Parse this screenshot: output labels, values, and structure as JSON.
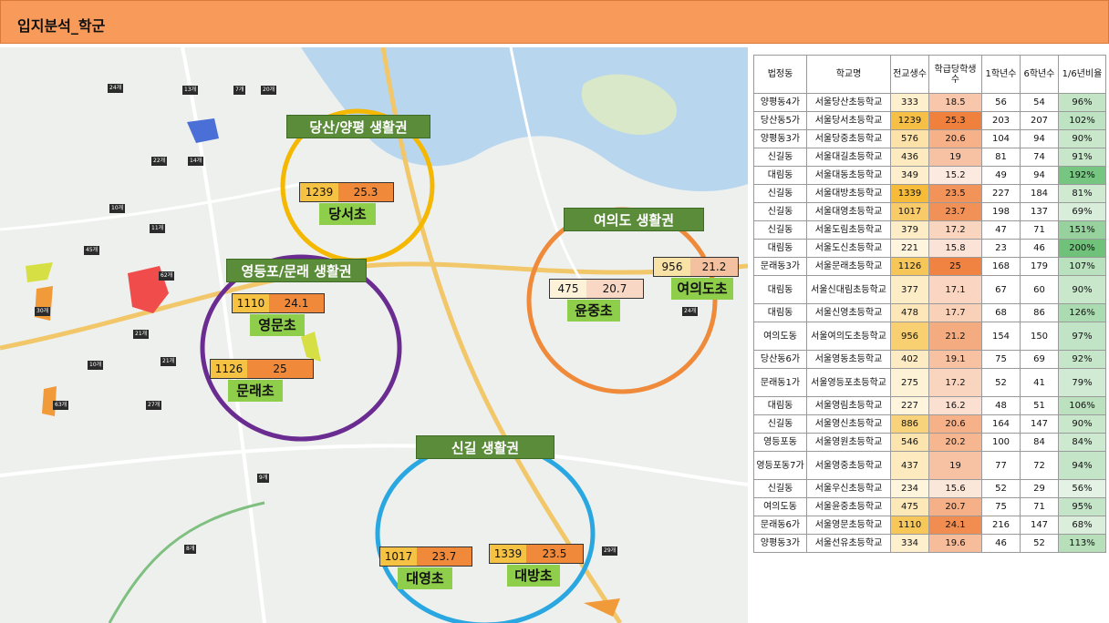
{
  "header": {
    "title": "입지분석_학군"
  },
  "map": {
    "zones": [
      {
        "label": "당산/양평 생활권",
        "color": "#f5b800"
      },
      {
        "label": "영등포/문래 생활권",
        "color": "#6a2c91"
      },
      {
        "label": "여의도  생활권",
        "color": "#ef8a3a"
      },
      {
        "label": "신길 생활권",
        "color": "#2aa7e0"
      }
    ],
    "schools": [
      {
        "name": "당서초",
        "students": "1239",
        "per_class": "25.3"
      },
      {
        "name": "영문초",
        "students": "1110",
        "per_class": "24.1"
      },
      {
        "name": "문래초",
        "students": "1126",
        "per_class": "25"
      },
      {
        "name": "윤중초",
        "students": "475",
        "per_class": "20.7"
      },
      {
        "name": "여의도초",
        "students": "956",
        "per_class": "21.2"
      },
      {
        "name": "대영초",
        "students": "1017",
        "per_class": "23.7"
      },
      {
        "name": "대방초",
        "students": "1339",
        "per_class": "23.5"
      }
    ]
  },
  "table": {
    "headers": [
      "법정동",
      "학교명",
      "전교생수",
      "학급당학생수",
      "1학년수",
      "6학년수",
      "1/6년비율"
    ],
    "rows": [
      [
        "양평동4가",
        "서울당산초등학교",
        "333",
        "18.5",
        "56",
        "54",
        "96%"
      ],
      [
        "당산동5가",
        "서울당서초등학교",
        "1239",
        "25.3",
        "203",
        "207",
        "102%"
      ],
      [
        "양평동3가",
        "서울당중초등학교",
        "576",
        "20.6",
        "104",
        "94",
        "90%"
      ],
      [
        "신길동",
        "서울대길초등학교",
        "436",
        "19",
        "81",
        "74",
        "91%"
      ],
      [
        "대림동",
        "서울대동초등학교",
        "349",
        "15.2",
        "49",
        "94",
        "192%"
      ],
      [
        "신길동",
        "서울대방초등학교",
        "1339",
        "23.5",
        "227",
        "184",
        "81%"
      ],
      [
        "신길동",
        "서울대영초등학교",
        "1017",
        "23.7",
        "198",
        "137",
        "69%"
      ],
      [
        "신길동",
        "서울도림초등학교",
        "379",
        "17.2",
        "47",
        "71",
        "151%"
      ],
      [
        "대림동",
        "서울도신초등학교",
        "221",
        "15.8",
        "23",
        "46",
        "200%"
      ],
      [
        "문래동3가",
        "서울문래초등학교",
        "1126",
        "25",
        "168",
        "179",
        "107%"
      ],
      [
        "대림동",
        "서울신대림초등학교",
        "377",
        "17.1",
        "67",
        "60",
        "90%"
      ],
      [
        "대림동",
        "서울신영초등학교",
        "478",
        "17.7",
        "68",
        "86",
        "126%"
      ],
      [
        "여의도동",
        "서울여의도초등학교",
        "956",
        "21.2",
        "154",
        "150",
        "97%"
      ],
      [
        "당산동6가",
        "서울영동초등학교",
        "402",
        "19.1",
        "75",
        "69",
        "92%"
      ],
      [
        "문래동1가",
        "서울영등포초등학교",
        "275",
        "17.2",
        "52",
        "41",
        "79%"
      ],
      [
        "대림동",
        "서울영림초등학교",
        "227",
        "16.2",
        "48",
        "51",
        "106%"
      ],
      [
        "신길동",
        "서울영신초등학교",
        "886",
        "20.6",
        "164",
        "147",
        "90%"
      ],
      [
        "영등포동",
        "서울영원초등학교",
        "546",
        "20.2",
        "100",
        "84",
        "84%"
      ],
      [
        "영등포동7가",
        "서울영중초등학교",
        "437",
        "19",
        "77",
        "72",
        "94%"
      ],
      [
        "신길동",
        "서울우신초등학교",
        "234",
        "15.6",
        "52",
        "29",
        "56%"
      ],
      [
        "여의도동",
        "서울윤중초등학교",
        "475",
        "20.7",
        "75",
        "71",
        "95%"
      ],
      [
        "문래동6가",
        "서울영문초등학교",
        "1110",
        "24.1",
        "216",
        "147",
        "68%"
      ],
      [
        "양평동3가",
        "서울선유초등학교",
        "334",
        "19.6",
        "46",
        "52",
        "113%"
      ]
    ]
  }
}
